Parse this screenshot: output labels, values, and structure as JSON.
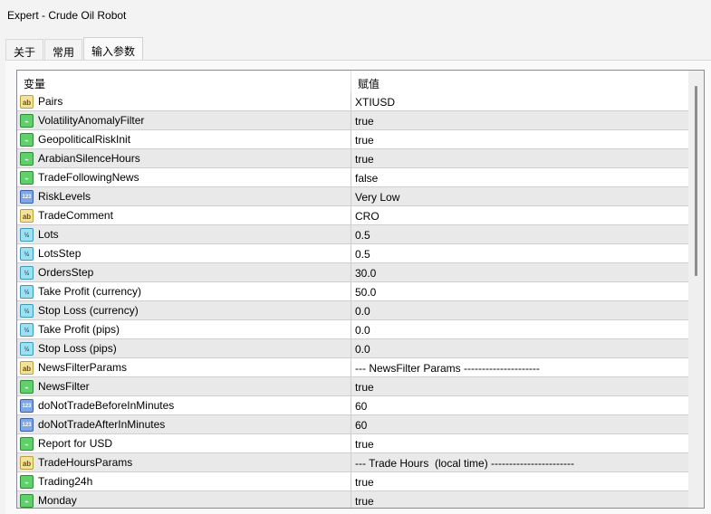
{
  "window": {
    "title": "Expert - Crude Oil Robot"
  },
  "tabs": [
    {
      "label": "关于"
    },
    {
      "label": "常用"
    },
    {
      "label": "输入参数"
    }
  ],
  "table": {
    "headers": {
      "variable": "变量",
      "value": "赋值"
    },
    "rows": [
      {
        "icon": "ab",
        "name": "Pairs",
        "value": "XTIUSD"
      },
      {
        "icon": "bool",
        "name": "VolatilityAnomalyFilter",
        "value": "true"
      },
      {
        "icon": "bool",
        "name": "GeopoliticalRiskInit",
        "value": "true"
      },
      {
        "icon": "bool",
        "name": "ArabianSilenceHours",
        "value": "true"
      },
      {
        "icon": "bool",
        "name": "TradeFollowingNews",
        "value": "false"
      },
      {
        "icon": "int",
        "name": "RiskLevels",
        "value": "Very Low"
      },
      {
        "icon": "ab",
        "name": "TradeComment",
        "value": "CRO"
      },
      {
        "icon": "dbl",
        "name": "Lots",
        "value": "0.5"
      },
      {
        "icon": "dbl",
        "name": "LotsStep",
        "value": "0.5"
      },
      {
        "icon": "dbl",
        "name": "OrdersStep",
        "value": "30.0"
      },
      {
        "icon": "dbl",
        "name": "Take Profit (currency)",
        "value": "50.0"
      },
      {
        "icon": "dbl",
        "name": "Stop Loss (currency)",
        "value": "0.0"
      },
      {
        "icon": "dbl",
        "name": "Take Profit (pips)",
        "value": "0.0"
      },
      {
        "icon": "dbl",
        "name": "Stop Loss (pips)",
        "value": "0.0"
      },
      {
        "icon": "ab",
        "name": "NewsFilterParams",
        "value": "--- NewsFilter Params ---------------------"
      },
      {
        "icon": "bool",
        "name": "NewsFilter",
        "value": "true"
      },
      {
        "icon": "int",
        "name": "doNotTradeBeforeInMinutes",
        "value": "60"
      },
      {
        "icon": "int",
        "name": "doNotTradeAfterInMinutes",
        "value": "60"
      },
      {
        "icon": "bool",
        "name": "Report for USD",
        "value": "true"
      },
      {
        "icon": "ab",
        "name": "TradeHoursParams",
        "value": "--- Trade Hours  (local time) -----------------------"
      },
      {
        "icon": "bool",
        "name": "Trading24h",
        "value": "true"
      },
      {
        "icon": "bool",
        "name": "Monday",
        "value": "true"
      }
    ]
  },
  "icon_glyphs": {
    "ab": "ab",
    "bool": "⌁",
    "int": "123",
    "dbl": "½"
  }
}
